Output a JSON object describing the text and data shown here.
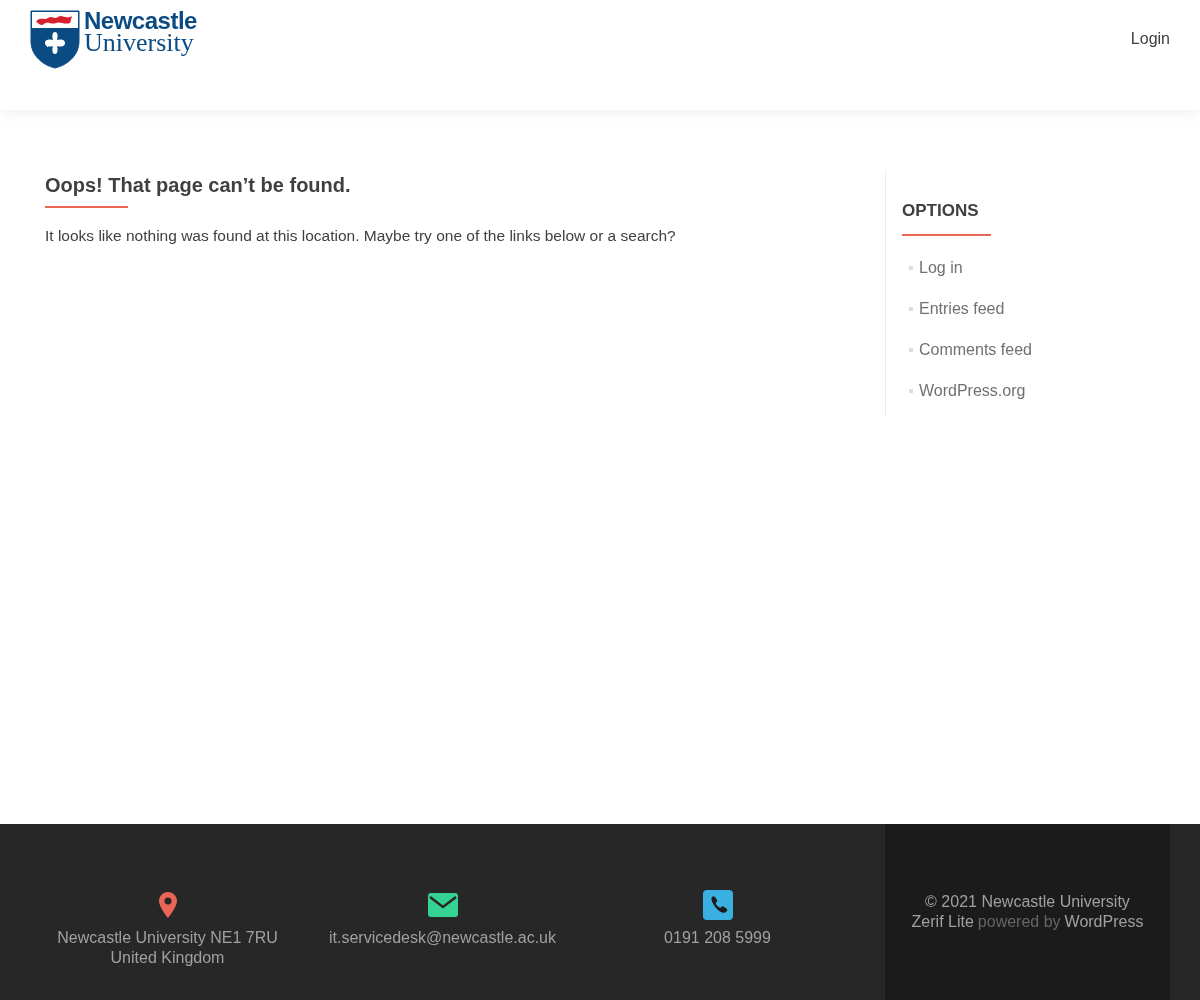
{
  "header": {
    "logo": {
      "line_1": "Newcastle",
      "line_2": "University"
    },
    "nav": [
      {
        "label": "Login"
      }
    ]
  },
  "main": {
    "title": "Oops! That page can’t be found.",
    "message": "It looks like nothing was found at this location. Maybe try one of the links below or a search?"
  },
  "sidebar": {
    "title": "OPTIONS",
    "links": [
      {
        "label": "Log in"
      },
      {
        "label": "Entries feed"
      },
      {
        "label": "Comments feed"
      },
      {
        "label": "WordPress.org"
      }
    ]
  },
  "footer": {
    "contacts": [
      {
        "kind": "address",
        "lines": [
          "Newcastle University NE1 7RU",
          "United Kingdom"
        ]
      },
      {
        "kind": "email",
        "lines": [
          "it.servicedesk@newcastle.ac.uk"
        ]
      },
      {
        "kind": "phone",
        "lines": [
          "0191 208 5999"
        ]
      }
    ],
    "copyright": "© 2021 Newcastle University",
    "theme_link": "Zerif Lite",
    "powered_by": "powered by",
    "platform_link": "WordPress"
  }
}
